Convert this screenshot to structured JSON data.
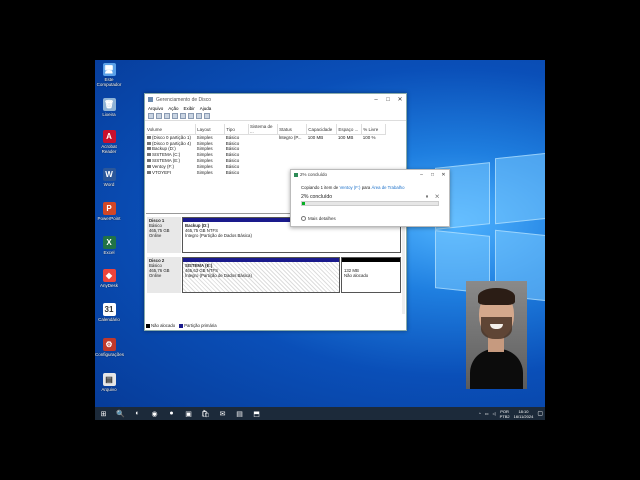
{
  "desktop": {
    "icons": [
      {
        "label": "Este Computador",
        "glyph": "🖥",
        "color": "#5aa0e8"
      },
      {
        "label": "Lixeira",
        "glyph": "🗑",
        "color": "#8fb3d6"
      },
      {
        "label": "Acrobat Reader",
        "glyph": "A",
        "color": "#c8102e"
      },
      {
        "label": "Word",
        "glyph": "W",
        "color": "#2b579a"
      },
      {
        "label": "PowerPoint",
        "glyph": "P",
        "color": "#d24726"
      },
      {
        "label": "Excel",
        "glyph": "X",
        "color": "#217346"
      },
      {
        "label": "AnyDesk",
        "glyph": "◆",
        "color": "#ef443b"
      },
      {
        "label": "Calendário",
        "glyph": "31",
        "color": "#ffffff"
      },
      {
        "label": "Configurações",
        "glyph": "⚙",
        "color": "#c0392b"
      },
      {
        "label": "Arquivo",
        "glyph": "▤",
        "color": "#e6e6e6"
      }
    ]
  },
  "disk_management": {
    "title": "Gerenciamento de Disco",
    "menu": [
      "Arquivo",
      "Ação",
      "Exibir",
      "Ajuda"
    ],
    "columns": [
      "Volume",
      "Layout",
      "Tipo",
      "Sistema de ...",
      "Status",
      "Capacidade",
      "Espaço ...",
      "% Livre"
    ],
    "rows": [
      [
        "(Disco 0 partição 1)",
        "Simples",
        "Básico",
        "",
        "Íntegro (P...",
        "100 MB",
        "100 MB",
        "100 %"
      ],
      [
        "(Disco 0 partição 4)",
        "Simples",
        "Básico",
        "",
        "",
        "",
        "",
        ""
      ],
      [
        "Backup (D:)",
        "Simples",
        "Básico",
        "",
        "",
        "",
        "",
        ""
      ],
      [
        "SISTEMA (C:)",
        "Simples",
        "Básico",
        "",
        "",
        "",
        "",
        ""
      ],
      [
        "SISTEMA (E:)",
        "Simples",
        "Básico",
        "",
        "",
        "",
        "",
        ""
      ],
      [
        "Ventoy (F:)",
        "Simples",
        "Básico",
        "",
        "",
        "",
        "",
        ""
      ],
      [
        "VTOYEFI",
        "Simples",
        "Básico",
        "",
        "",
        "",
        "",
        ""
      ]
    ],
    "disks": [
      {
        "name": "Disco 1",
        "type": "Básico",
        "size": "465,75 GB",
        "status": "Online",
        "partitions": [
          {
            "name": "Backup (D:)",
            "size": "465,75 GB NTFS",
            "status": "Íntegro (Partição de Dados Básica)"
          }
        ]
      },
      {
        "name": "Disco 2",
        "type": "Básico",
        "size": "465,76 GB",
        "status": "Online",
        "partitions": [
          {
            "name": "SISTEMA (E:)",
            "size": "465,63 GB NTFS",
            "status": "Íntegro (Partição de Dados Básica)"
          },
          {
            "name": "",
            "size": "132 MB",
            "status": "Não alocado"
          }
        ]
      }
    ],
    "legend": {
      "unallocated": "Não alocado",
      "primary": "Partição primária"
    },
    "colors": {
      "primary_stripe": "#1a1a8c",
      "unallocated": "#000000"
    }
  },
  "copy_dialog": {
    "title": "2% concluído",
    "line_prefix": "Copiando 1 item de",
    "source": "Ventoy (F:)",
    "line_mid": "para",
    "destination": "Área de Trabalho",
    "percent_text": "2% concluído",
    "progress": 0.02,
    "more_details": "Mais detalhes"
  },
  "taskbar": {
    "apps": [
      "⊞",
      "🔍",
      "◐",
      "◉",
      "●",
      "▣",
      "🛍",
      "✉",
      "▤",
      "⬒"
    ],
    "lang": "POR",
    "lang2": "PTB2",
    "time": "18:10",
    "date": "16/11/2024"
  }
}
